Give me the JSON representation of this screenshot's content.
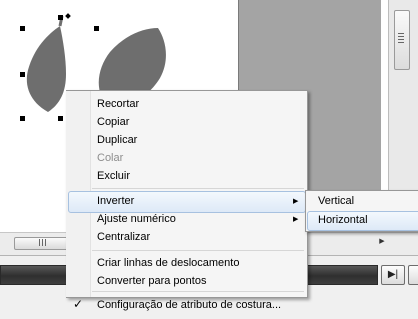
{
  "context_menu": {
    "items": [
      {
        "label": "Recortar",
        "enabled": true
      },
      {
        "label": "Copiar",
        "enabled": true
      },
      {
        "label": "Duplicar",
        "enabled": true
      },
      {
        "label": "Colar",
        "enabled": false
      },
      {
        "label": "Excluir",
        "enabled": true
      },
      {
        "label": "Inverter",
        "enabled": true,
        "submenu": true,
        "highlighted": true
      },
      {
        "label": "Ajuste numérico",
        "enabled": true,
        "submenu": true
      },
      {
        "label": "Centralizar",
        "enabled": true
      },
      {
        "label": "Criar linhas de deslocamento",
        "enabled": true
      },
      {
        "label": "Converter para pontos",
        "enabled": true
      },
      {
        "label": "Configuração de atributo de costura...",
        "enabled": true,
        "checked": true
      }
    ]
  },
  "submenu": {
    "items": [
      {
        "label": "Vertical"
      },
      {
        "label": "Horizontal",
        "highlighted": true
      }
    ]
  },
  "colors": {
    "canvas": "#ffffff",
    "shape_fill": "#6e6e6e",
    "grey_panel": "#a4a4a4",
    "highlight_border": "#a7c1e0",
    "disabled_text": "#8d8d8d"
  },
  "icons": {
    "checkmark": "✓",
    "submenu_arrow": "▶",
    "play_end": "▶|"
  }
}
